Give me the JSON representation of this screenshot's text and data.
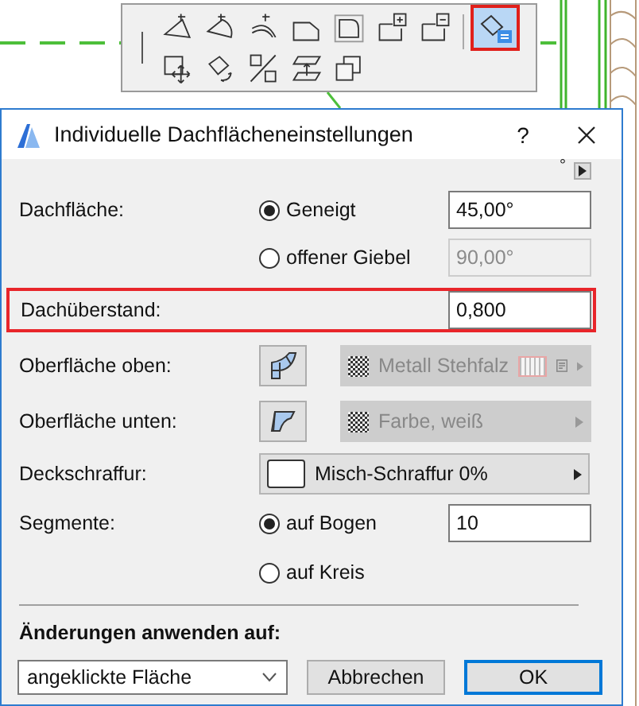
{
  "toolbar": {
    "tools": [
      {
        "kind": "triangle",
        "selected": false
      },
      {
        "kind": "sector",
        "selected": false
      },
      {
        "kind": "arc",
        "selected": false
      },
      {
        "kind": "chamfer",
        "selected": false
      },
      {
        "kind": "rounded",
        "selected": false
      },
      {
        "kind": "add",
        "selected": false
      },
      {
        "kind": "subtract",
        "selected": false
      },
      {
        "kind": "settings",
        "selected": true
      },
      {
        "kind": "move",
        "selected": false
      },
      {
        "kind": "rotate",
        "selected": false
      },
      {
        "kind": "split",
        "selected": false
      },
      {
        "kind": "elevate",
        "selected": false
      },
      {
        "kind": "copy",
        "selected": false
      }
    ]
  },
  "dialog": {
    "title": "Individuelle Dachflächeneinstellungen",
    "help": "?",
    "unit_mark": "°",
    "roof_plane": {
      "label": "Dachfläche:",
      "options": [
        {
          "label": "Geneigt",
          "selected": true,
          "value": "45,00°",
          "disabled": false
        },
        {
          "label": "offener Giebel",
          "selected": false,
          "value": "90,00°",
          "disabled": true
        }
      ]
    },
    "overhang": {
      "label": "Dachüberstand:",
      "value": "0,800",
      "highlighted": true
    },
    "surfaces": [
      {
        "kind": "top",
        "label": "Oberfläche oben:",
        "material": "Metall Stehfalz",
        "pattern": true,
        "disabled": true
      },
      {
        "kind": "bottom",
        "label": "Oberfläche unten:",
        "material": "Farbe, weiß",
        "pattern": false,
        "disabled": true
      }
    ],
    "cover_fill": {
      "label": "Deckschraffur:",
      "value": "Misch-Schraffur 0%"
    },
    "segments": {
      "label": "Segmente:",
      "options": [
        {
          "label": "auf Bogen",
          "selected": true,
          "value": "10"
        },
        {
          "label": "auf Kreis",
          "selected": false
        }
      ]
    },
    "apply": {
      "label": "Änderungen anwenden auf:",
      "value": "angeklickte Fläche"
    },
    "buttons": [
      {
        "label": "Abbrechen",
        "default": false
      },
      {
        "label": "OK",
        "default": true
      }
    ]
  }
}
